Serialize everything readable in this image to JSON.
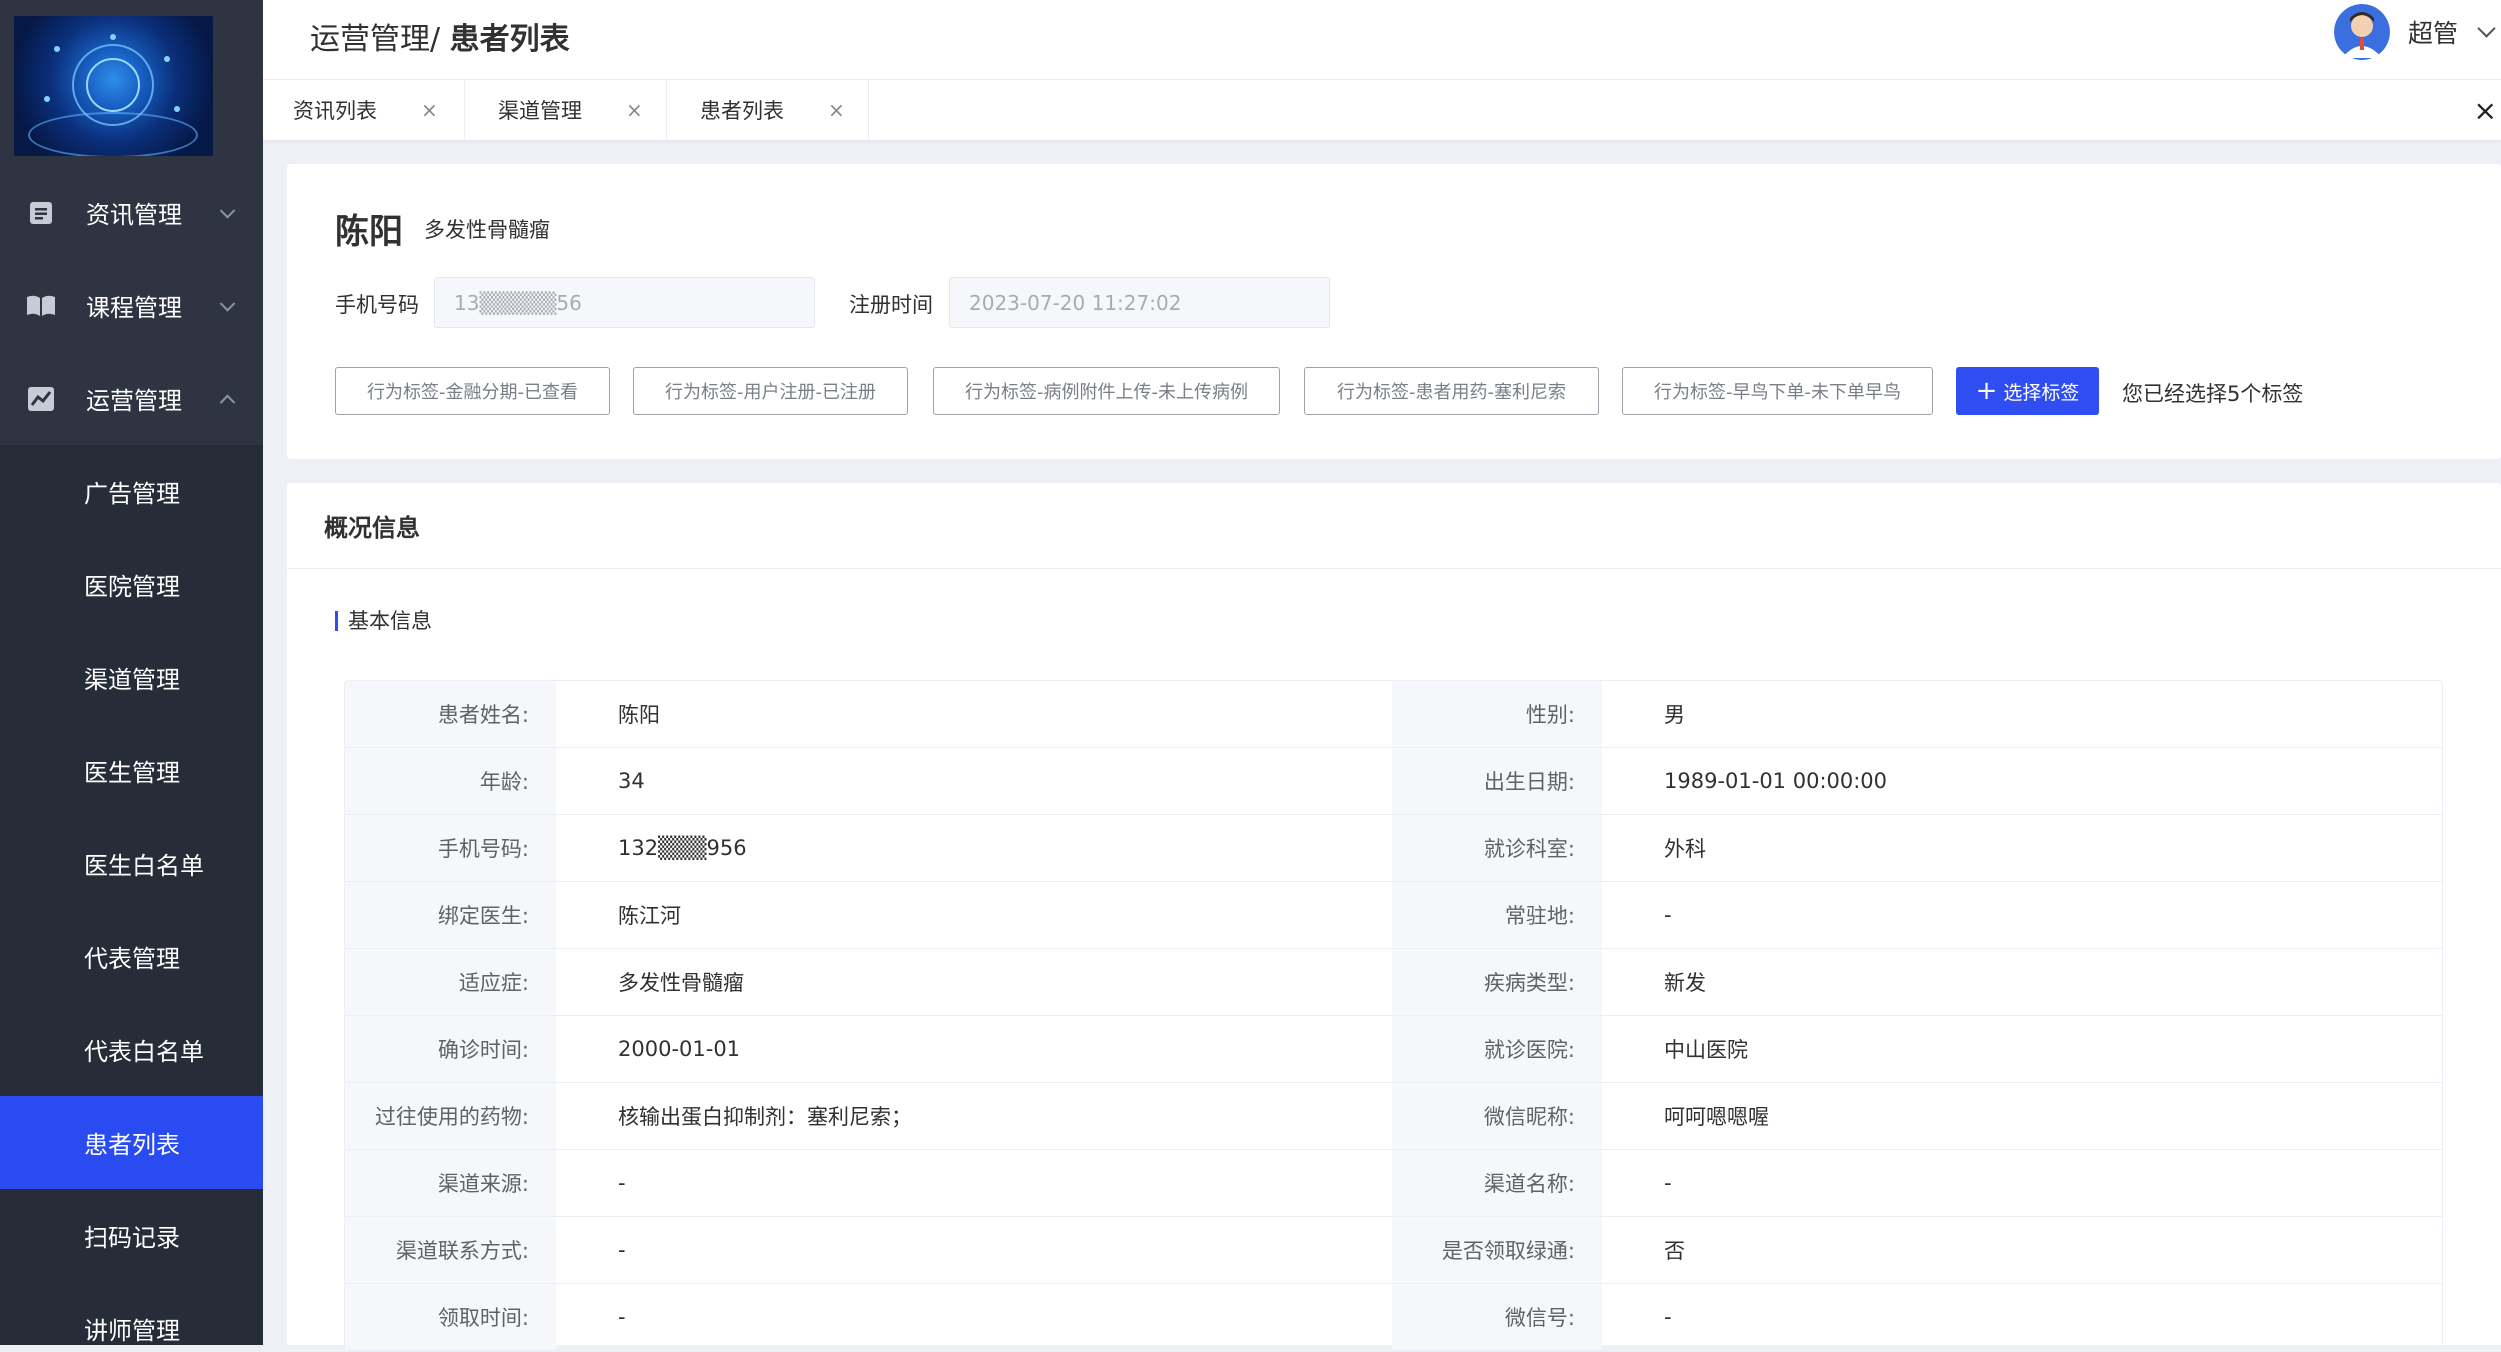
{
  "sidebar": {
    "groups": [
      {
        "label": "资讯管理",
        "icon": "document-icon",
        "expanded": false
      },
      {
        "label": "课程管理",
        "icon": "book-icon",
        "expanded": false
      },
      {
        "label": "运营管理",
        "icon": "chart-icon",
        "expanded": true
      }
    ],
    "sub_items": [
      "广告管理",
      "医院管理",
      "渠道管理",
      "医生管理",
      "医生白名单",
      "代表管理",
      "代表白名单",
      "患者列表",
      "扫码记录",
      "讲师管理"
    ],
    "active_item": "患者列表",
    "active_color": "#2b4bf2"
  },
  "header": {
    "breadcrumb_parent": "运营管理/",
    "breadcrumb_current": "患者列表",
    "user_name": "超管"
  },
  "tabs": [
    {
      "label": "资讯列表",
      "close": "×"
    },
    {
      "label": "渠道管理",
      "close": "×"
    },
    {
      "label": "患者列表",
      "close": "×"
    }
  ],
  "tabs_close_all": "×",
  "patient": {
    "name": "陈阳",
    "disease": "多发性骨髓瘤",
    "phone_label": "手机号码",
    "phone_value": "13▒▒▒▒▒56",
    "register_label": "注册时间",
    "register_value": "2023-07-20 11:27:02"
  },
  "tags": [
    "行为标签-金融分期-已查看",
    "行为标签-用户注册-已注册",
    "行为标签-病例附件上传-未上传病例",
    "行为标签-患者用药-塞利尼索",
    "行为标签-早鸟下单-未下单早鸟"
  ],
  "select_tag_button": {
    "icon": "+",
    "label": "选择标签"
  },
  "tag_count_text": "您已经选择5个标签",
  "primary_color": "#2f4df1",
  "overview": {
    "title": "概况信息",
    "section_title": "基本信息",
    "rows": [
      {
        "l1": "患者姓名:",
        "v1": "陈阳",
        "l2": "性别:",
        "v2": "男"
      },
      {
        "l1": "年龄:",
        "v1": "34",
        "l2": "出生日期:",
        "v2": "1989-01-01 00:00:00"
      },
      {
        "l1": "手机号码:",
        "v1": "132▒▒▒956",
        "l2": "就诊科室:",
        "v2": "外科"
      },
      {
        "l1": "绑定医生:",
        "v1": "陈江河",
        "l2": "常驻地:",
        "v2": "-"
      },
      {
        "l1": "适应症:",
        "v1": "多发性骨髓瘤",
        "l2": "疾病类型:",
        "v2": "新发"
      },
      {
        "l1": "确诊时间:",
        "v1": "2000-01-01",
        "l2": "就诊医院:",
        "v2": "中山医院"
      },
      {
        "l1": "过往使用的药物:",
        "v1": "核输出蛋白抑制剂：塞利尼索；",
        "l2": "微信昵称:",
        "v2": "呵呵嗯嗯喔"
      },
      {
        "l1": "渠道来源:",
        "v1": "-",
        "l2": "渠道名称:",
        "v2": "-"
      },
      {
        "l1": "渠道联系方式:",
        "v1": "-",
        "l2": "是否领取绿通:",
        "v2": "否"
      },
      {
        "l1": "领取时间:",
        "v1": "-",
        "l2": "微信号:",
        "v2": "-"
      }
    ]
  }
}
